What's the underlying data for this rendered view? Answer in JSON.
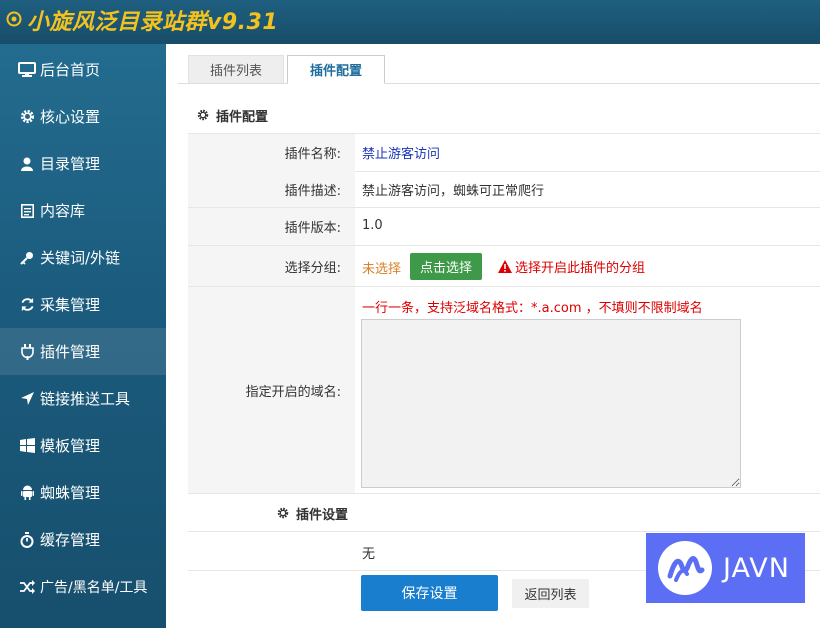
{
  "app": {
    "title": "小旋风泛目录站群v9.31"
  },
  "sidebar": {
    "items": [
      {
        "label": "后台首页",
        "icon": "monitor-icon"
      },
      {
        "label": "核心设置",
        "icon": "gear-icon"
      },
      {
        "label": "目录管理",
        "icon": "user-icon"
      },
      {
        "label": "内容库",
        "icon": "list-icon"
      },
      {
        "label": "关键词/外链",
        "icon": "key-icon"
      },
      {
        "label": "采集管理",
        "icon": "refresh-icon"
      },
      {
        "label": "插件管理",
        "icon": "plug-icon"
      },
      {
        "label": "链接推送工具",
        "icon": "send-icon"
      },
      {
        "label": "模板管理",
        "icon": "windows-icon"
      },
      {
        "label": "蜘蛛管理",
        "icon": "android-icon"
      },
      {
        "label": "缓存管理",
        "icon": "timer-icon"
      },
      {
        "label": "广告/黑名单/工具",
        "icon": "shuffle-icon"
      }
    ],
    "active_index": 6
  },
  "tabs": {
    "list": "插件列表",
    "config": "插件配置",
    "active": "插件配置"
  },
  "form": {
    "section_title": "插件配置",
    "name_label": "插件名称:",
    "name_value": "禁止游客访问",
    "desc_label": "插件描述:",
    "desc_value": "禁止游客访问，蜘蛛可正常爬行",
    "version_label": "插件版本:",
    "version_value": "1.0",
    "group_label": "选择分组:",
    "group_value": "未选择",
    "group_button": "点击选择",
    "group_warning": "选择开启此插件的分组",
    "domain_label": "指定开启的域名:",
    "domain_hint": "一行一条，支持泛域名格式：*.a.com ，不填则不限制域名",
    "domain_value": ""
  },
  "settings": {
    "section_title": "插件设置",
    "value": "无"
  },
  "actions": {
    "save": "保存设置",
    "back": "返回列表"
  },
  "watermark": {
    "text": "JAVN"
  },
  "colors": {
    "header_bg": "#1c5a79",
    "logo_text": "#f4c21f",
    "primary": "#1a7ecf",
    "success": "#3e9a48",
    "danger": "#dd0000"
  }
}
